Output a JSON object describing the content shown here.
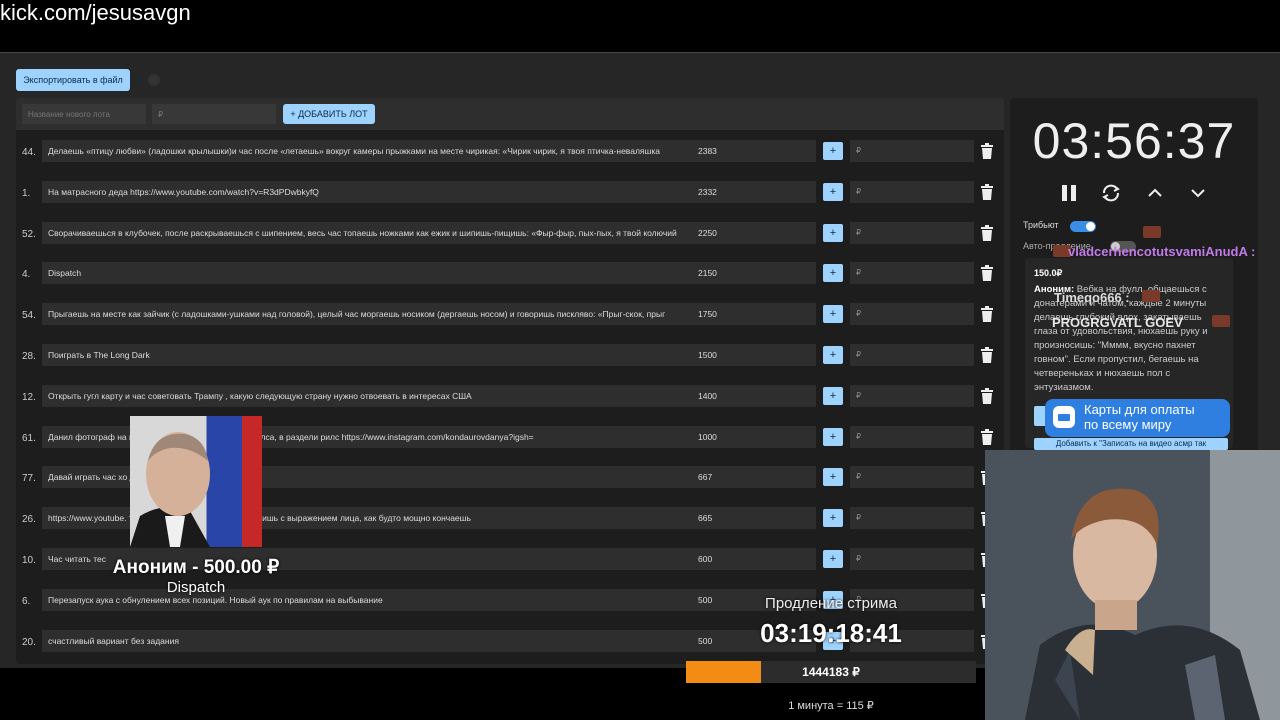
{
  "site_url": "kick.com/jesusavgn",
  "toolbar": {
    "export_label": "Экспортировать в файл"
  },
  "new_lot": {
    "name_placeholder": "Название нового лота",
    "amount_placeholder": "₽",
    "add_label": "+ ДОБАВИТЬ ЛОТ"
  },
  "lots": [
    {
      "num": "44.",
      "title": "Делаешь «птицу любви» (ладошки крылышки)и час после «летаешь» вокруг камеры прыжками на месте чирикая: «Чирик чирик, я твоя птичка-неваляшка",
      "amount": "2383",
      "plus": "+",
      "rub": "₽"
    },
    {
      "num": "1.",
      "title": "На матрасного деда https://www.youtube.com/watch?v=R3dPDwbkyfQ",
      "amount": "2332",
      "plus": "+",
      "rub": "₽"
    },
    {
      "num": "52.",
      "title": "Сворачиваешься в клубочек, после раскрываешься с шипением, весь час топаешь ножками как ежик и шипишь-пищишь: «Фыр-фыр, пых-пых, я твой колючий",
      "amount": "2250",
      "plus": "+",
      "rub": "₽"
    },
    {
      "num": "4.",
      "title": "Dispatch",
      "amount": "2150",
      "plus": "+",
      "rub": "₽"
    },
    {
      "num": "54.",
      "title": "Прыгаешь на месте как зайчик (с ладошками-ушками над головой), целый час моргаешь носиком (дергаешь носом) и говоришь писклявo: «Прыг-скок, прыг",
      "amount": "1750",
      "plus": "+",
      "rub": "₽"
    },
    {
      "num": "28.",
      "title": "Поиграть в The Long Dark",
      "amount": "1500",
      "plus": "+",
      "rub": "₽"
    },
    {
      "num": "12.",
      "title": "Открыть гугл карту и час советовать Трампу , какую следующую страну нужно отвоевать в интересах США",
      "amount": "1400",
      "plus": "+",
      "rub": "₽"
    },
    {
      "num": "61.",
      "title": "Данил фотограф на                              грамм И посмотрети первые 3 рилса, в раздели рилс https://www.instagram.com/kondaurovdanya?igsh=",
      "amount": "1000",
      "plus": "+",
      "rub": "₽"
    },
    {
      "num": "77.",
      "title": "Давай играть час хо                              дательными отзывами",
      "amount": "667",
      "plus": "+",
      "rub": "₽"
    },
    {
      "num": "26.",
      "title": "https://www.youtube.                              тришь 29 минут. все 29 минут сидишь с выражением лица, как будто мощно кончаешь",
      "amount": "665",
      "plus": "+",
      "rub": "₽"
    },
    {
      "num": "10.",
      "title": "Час читать тес",
      "amount": "600",
      "plus": "+",
      "rub": "₽"
    },
    {
      "num": "6.",
      "title": "Перезапуск аука с обнулением всех позиций. Новый аук по правилам на выбывание",
      "amount": "500",
      "plus": "+",
      "rub": "₽"
    },
    {
      "num": "20.",
      "title": "счастливый вариант без задания",
      "amount": "500",
      "plus": "+",
      "rub": "₽"
    }
  ],
  "timer": {
    "value": "03:56:37",
    "tribute_label": "Трибьют",
    "auto_label": "Авто-продление"
  },
  "donation": {
    "amount": "150.0₽",
    "author": "Аноним:",
    "text": " Вебка на фулл, общаешься с донатерами и чатом, каждые 2 минуты делаешь глубокий вдох, закатываешь глаза от удовольствия, нюхаешь руку и произносишь: \"Мммм, вкусно пахнет говном\". Если пропустил, бегаешь на четвереньках и нюхаешь пол с энтузиазмом.",
    "button": "Добавить к \"Записать на видео асмр так"
  },
  "chat": [
    {
      "name": "vladcerhencotutsvamiAnudA :",
      "color": "#c07be8"
    },
    {
      "name": "Timeqo666 :",
      "color": "#dddddd"
    },
    {
      "name": "PROGRGVATL GOEV",
      "color": "#e8e8e8"
    }
  ],
  "ad": {
    "line1": "Карты для оплаты",
    "line2": "по всему миру"
  },
  "donor_alert": {
    "name": "Аноним - 500.00 ₽",
    "message": "Dispatch"
  },
  "extension": {
    "title": "Продление стрима",
    "timer": "03:19:18:41",
    "sum": "1444183 ₽",
    "progress": 0.26,
    "progress_color": "#f28c14",
    "rate": "1 минута = 115 ₽"
  },
  "colors": {
    "accent": "#9fd3ff",
    "panel": "#1d1d1d",
    "field": "#2e2e2e"
  },
  "icons": [
    "trash-icon",
    "pause-icon",
    "refresh-icon",
    "chevron-up-icon",
    "chevron-down-icon",
    "card-icon"
  ]
}
